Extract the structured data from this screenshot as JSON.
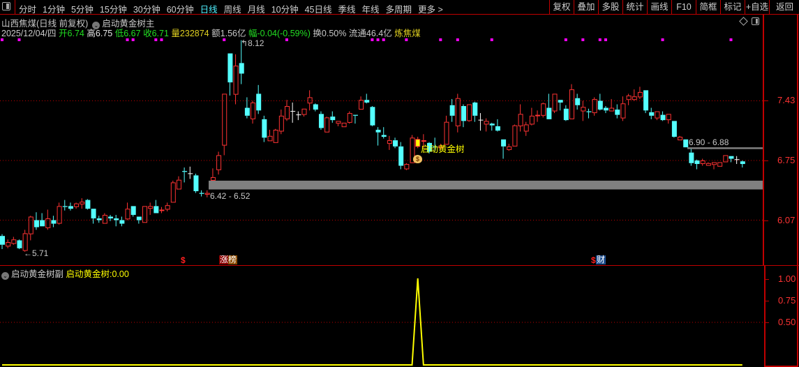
{
  "toolbar": {
    "periods": [
      "分时",
      "1分钟",
      "5分钟",
      "15分钟",
      "30分钟",
      "60分钟",
      "日线",
      "周线",
      "月线",
      "10分钟",
      "45日线",
      "季线",
      "年线",
      "多周期",
      "更多 >"
    ],
    "active_period": "日线",
    "right_buttons": [
      "复权",
      "叠加",
      "多股",
      "统计",
      "画线",
      "F10",
      "简框",
      "标记",
      "+自选",
      "返回"
    ]
  },
  "header": {
    "title": "山西焦煤(日线 前复权)",
    "indicator": "启动黄金树主"
  },
  "info": {
    "date": "2025/12/04/四",
    "open_label": "开",
    "open": "6.74",
    "high_label": "高",
    "high": "6.75",
    "low_label": "低",
    "low": "6.67",
    "close_label": "收",
    "close": "6.71",
    "vol_label": "量",
    "vol": "232874",
    "amt_label": "额",
    "amt": "1.56亿",
    "chg_label": "幅",
    "chg": "-0.04(-0.59%)",
    "turnover_label": "换",
    "turnover": "0.50%",
    "float_label": "流通",
    "float": "46.4亿",
    "sector": "炼焦煤"
  },
  "annotations": {
    "high_flag": "8.12",
    "low_flag": "5.71",
    "zone_low": "6.42 - 6.52",
    "zone_high": "6.90 - 6.88",
    "signal_label": "启动黄金树",
    "marker_dollar_1": "$",
    "marker_board": "涨榜",
    "marker_dollar_2": "$",
    "marker_finance": "财"
  },
  "lower_panel": {
    "name": "启动黄金树副",
    "series_label": "启动黄金树:",
    "series_value": "0.00"
  },
  "colors": {
    "up": "#ff3333",
    "down": "#54ffff",
    "flat": "#ffffff",
    "grid": "#c00000",
    "signal": "#ffff00",
    "event_dot": "#ff00ff",
    "zone": "#808080"
  },
  "chart_data": [
    {
      "type": "candlestick",
      "ylabel_ticks": [
        "7.43",
        "6.75",
        "6.07"
      ],
      "y_ticks": [
        7.43,
        6.75,
        6.07
      ],
      "ylim": [
        5.55,
        8.3
      ],
      "grid": "horizontal dotted at ticks",
      "zones": [
        [
          6.42,
          6.52
        ],
        [
          6.88,
          6.9
        ]
      ],
      "signal_index": 73,
      "event_dot_indices": [
        0,
        3,
        22,
        23,
        27,
        28,
        39,
        50,
        65,
        66,
        67,
        71,
        77,
        80,
        86,
        99,
        102,
        105,
        106,
        116,
        128
      ],
      "ohlc": [
        [
          5.89,
          5.91,
          5.74,
          5.79
        ],
        [
          5.77,
          5.85,
          5.75,
          5.82
        ],
        [
          5.8,
          5.88,
          5.79,
          5.85
        ],
        [
          5.84,
          5.85,
          5.74,
          5.75
        ],
        [
          5.72,
          5.96,
          5.71,
          5.92
        ],
        [
          5.91,
          6.12,
          5.84,
          6.11
        ],
        [
          6.07,
          6.16,
          5.96,
          5.99
        ],
        [
          6.07,
          6.15,
          6.0,
          6.0
        ],
        [
          5.98,
          6.19,
          5.96,
          6.09
        ],
        [
          6.07,
          6.12,
          5.99,
          6.03
        ],
        [
          6.03,
          6.27,
          6.02,
          6.23
        ],
        [
          6.23,
          6.3,
          6.18,
          6.22
        ],
        [
          6.23,
          6.27,
          6.18,
          6.2
        ],
        [
          6.22,
          6.27,
          6.2,
          6.26
        ],
        [
          6.25,
          6.32,
          6.2,
          6.28
        ],
        [
          6.3,
          6.31,
          6.19,
          6.2
        ],
        [
          6.2,
          6.2,
          6.03,
          6.09
        ],
        [
          6.09,
          6.12,
          6.04,
          6.07
        ],
        [
          6.03,
          6.15,
          6.03,
          6.13
        ],
        [
          6.11,
          6.13,
          6.06,
          6.09
        ],
        [
          6.09,
          6.13,
          6.0,
          6.07
        ],
        [
          6.07,
          6.11,
          6.0,
          6.03
        ],
        [
          6.08,
          6.27,
          6.07,
          6.2
        ],
        [
          6.23,
          6.23,
          6.11,
          6.13
        ],
        [
          6.11,
          6.11,
          6.03,
          6.07
        ],
        [
          6.04,
          6.23,
          6.04,
          6.23
        ],
        [
          6.2,
          6.27,
          6.13,
          6.23
        ],
        [
          6.23,
          6.3,
          6.15,
          6.15
        ],
        [
          6.18,
          6.22,
          6.15,
          6.19
        ],
        [
          6.19,
          6.27,
          6.17,
          6.24
        ],
        [
          6.27,
          6.52,
          6.27,
          6.5
        ],
        [
          6.42,
          6.57,
          6.42,
          6.53
        ],
        [
          6.63,
          6.67,
          6.5,
          6.62
        ],
        [
          6.6,
          6.68,
          6.54,
          6.6
        ],
        [
          6.58,
          6.6,
          6.38,
          6.4
        ],
        [
          6.38,
          6.41,
          6.34,
          6.37
        ],
        [
          6.36,
          6.41,
          6.33,
          6.38
        ],
        [
          6.52,
          6.66,
          6.52,
          6.56
        ],
        [
          6.64,
          6.85,
          6.59,
          6.81
        ],
        [
          6.92,
          7.51,
          6.81,
          7.51
        ],
        [
          7.97,
          7.97,
          7.49,
          7.64
        ],
        [
          7.5,
          7.96,
          7.39,
          7.83
        ],
        [
          7.86,
          8.12,
          7.62,
          7.74
        ],
        [
          7.35,
          7.47,
          7.23,
          7.26
        ],
        [
          7.22,
          7.43,
          7.17,
          7.41
        ],
        [
          7.51,
          7.61,
          7.28,
          7.32
        ],
        [
          7.22,
          7.26,
          6.96,
          7.01
        ],
        [
          6.97,
          7.1,
          6.97,
          7.03
        ],
        [
          6.95,
          7.11,
          6.95,
          7.1
        ],
        [
          7.08,
          7.33,
          7.05,
          7.26
        ],
        [
          7.22,
          7.44,
          7.2,
          7.37
        ],
        [
          7.31,
          7.41,
          7.18,
          7.31
        ],
        [
          7.27,
          7.31,
          7.21,
          7.27
        ],
        [
          7.27,
          7.34,
          7.25,
          7.34
        ],
        [
          7.4,
          7.55,
          7.32,
          7.47
        ],
        [
          7.39,
          7.4,
          7.31,
          7.33
        ],
        [
          7.28,
          7.31,
          7.1,
          7.12
        ],
        [
          7.07,
          7.25,
          7.07,
          7.24
        ],
        [
          7.25,
          7.31,
          7.18,
          7.21
        ],
        [
          7.17,
          7.2,
          7.14,
          7.2
        ],
        [
          7.13,
          7.18,
          7.13,
          7.18
        ],
        [
          7.18,
          7.31,
          7.17,
          7.29
        ],
        [
          7.27,
          7.27,
          7.17,
          7.26
        ],
        [
          7.33,
          7.48,
          7.33,
          7.44
        ],
        [
          7.44,
          7.51,
          7.4,
          7.41
        ],
        [
          7.36,
          7.37,
          7.14,
          7.15
        ],
        [
          7.1,
          7.13,
          6.92,
          7.07
        ],
        [
          7.04,
          7.13,
          7.0,
          7.02
        ],
        [
          6.94,
          7.03,
          6.87,
          6.98
        ],
        [
          6.98,
          7.01,
          6.89,
          6.91
        ],
        [
          6.91,
          6.96,
          6.65,
          6.69
        ],
        [
          6.65,
          6.72,
          6.64,
          6.71
        ],
        [
          6.72,
          7.04,
          6.72,
          7.01
        ],
        [
          6.91,
          7.02,
          6.89,
          6.99
        ],
        [
          6.97,
          7.05,
          6.89,
          6.98
        ],
        [
          6.95,
          6.96,
          6.83,
          6.85
        ],
        [
          6.91,
          7.01,
          6.85,
          6.9
        ],
        [
          6.89,
          6.94,
          6.88,
          6.92
        ],
        [
          6.93,
          7.26,
          6.93,
          7.19
        ],
        [
          7.38,
          7.45,
          7.19,
          7.26
        ],
        [
          7.14,
          7.51,
          7.07,
          7.46
        ],
        [
          7.37,
          7.39,
          7.13,
          7.2
        ],
        [
          7.2,
          7.39,
          7.19,
          7.39
        ],
        [
          7.41,
          7.42,
          7.19,
          7.26
        ],
        [
          7.21,
          7.29,
          7.09,
          7.21
        ],
        [
          7.16,
          7.23,
          7.08,
          7.2
        ],
        [
          7.17,
          7.18,
          7.09,
          7.15
        ],
        [
          7.14,
          7.22,
          7.08,
          7.09
        ],
        [
          6.99,
          6.99,
          6.77,
          6.91
        ],
        [
          6.87,
          6.94,
          6.86,
          6.91
        ],
        [
          6.91,
          7.16,
          6.91,
          7.15
        ],
        [
          7.14,
          7.39,
          7.08,
          7.28
        ],
        [
          7.08,
          7.19,
          7.03,
          7.16
        ],
        [
          7.16,
          7.35,
          7.15,
          7.26
        ],
        [
          7.26,
          7.32,
          7.19,
          7.27
        ],
        [
          7.26,
          7.41,
          7.24,
          7.4
        ],
        [
          7.35,
          7.51,
          7.22,
          7.22
        ],
        [
          7.31,
          7.51,
          7.29,
          7.51
        ],
        [
          7.44,
          7.44,
          7.32,
          7.41
        ],
        [
          7.34,
          7.38,
          7.2,
          7.21
        ],
        [
          7.22,
          7.62,
          7.22,
          7.56
        ],
        [
          7.46,
          7.51,
          7.33,
          7.38
        ],
        [
          7.31,
          7.43,
          7.2,
          7.36
        ],
        [
          7.31,
          7.34,
          7.23,
          7.3
        ],
        [
          7.29,
          7.47,
          7.26,
          7.45
        ],
        [
          7.43,
          7.51,
          7.32,
          7.33
        ],
        [
          7.35,
          7.37,
          7.29,
          7.32
        ],
        [
          7.31,
          7.45,
          7.31,
          7.35
        ],
        [
          7.33,
          7.39,
          7.23,
          7.27
        ],
        [
          7.23,
          7.48,
          7.2,
          7.4
        ],
        [
          7.44,
          7.51,
          7.38,
          7.49
        ],
        [
          7.44,
          7.56,
          7.43,
          7.48
        ],
        [
          7.47,
          7.59,
          7.45,
          7.53
        ],
        [
          7.55,
          7.55,
          7.29,
          7.32
        ],
        [
          7.3,
          7.35,
          7.22,
          7.26
        ],
        [
          7.23,
          7.31,
          7.21,
          7.31
        ],
        [
          7.27,
          7.31,
          7.2,
          7.21
        ],
        [
          7.21,
          7.28,
          7.17,
          7.28
        ],
        [
          7.2,
          7.2,
          7.01,
          7.02
        ],
        [
          6.98,
          7.03,
          6.98,
          7.02
        ],
        [
          6.99,
          6.99,
          6.9,
          6.9
        ],
        [
          6.84,
          6.88,
          6.69,
          6.72
        ],
        [
          6.75,
          6.76,
          6.65,
          6.71
        ],
        [
          6.71,
          6.77,
          6.69,
          6.75
        ],
        [
          6.69,
          6.73,
          6.69,
          6.72
        ],
        [
          6.7,
          6.73,
          6.65,
          6.73
        ],
        [
          6.68,
          6.73,
          6.68,
          6.73
        ],
        [
          6.73,
          6.81,
          6.73,
          6.81
        ],
        [
          6.8,
          6.8,
          6.73,
          6.77
        ],
        [
          6.76,
          6.8,
          6.71,
          6.76
        ],
        [
          6.74,
          6.75,
          6.67,
          6.71
        ]
      ]
    },
    {
      "type": "line",
      "series": [
        {
          "name": "启动黄金树",
          "signal_index": 73,
          "signal_value": 1,
          "other_value": 0
        }
      ],
      "y_ticks": [
        1.0,
        0.75,
        0.5
      ],
      "ylabel_ticks": [
        "1.00",
        "0.75",
        "0.50"
      ],
      "ylim": [
        0,
        1.0
      ]
    }
  ]
}
